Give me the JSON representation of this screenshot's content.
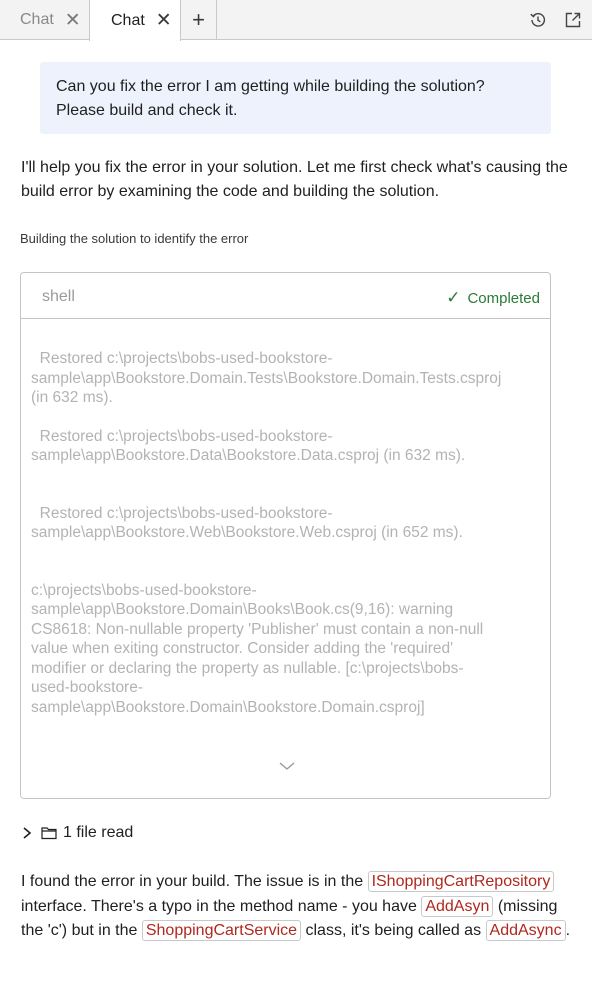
{
  "tabs": [
    {
      "label": "Chat",
      "active": false
    },
    {
      "label": "Chat",
      "active": true
    }
  ],
  "tab_close_glyph": "✕",
  "new_tab_glyph": "+",
  "toolbar_icons": [
    "history-icon",
    "popout-icon"
  ],
  "user_message": "Can you fix the error I am getting while building the solution? Please build and check it.",
  "assistant_intro": "I'll help you fix the error in your solution. Let me first check what's causing the build error by examining the code and building the solution.",
  "step_label": "Building the solution to identify the error",
  "terminal": {
    "title": "shell",
    "status": "Completed",
    "lines": [
      "  Restored c:\\projects\\bobs-used-bookstore-\nsample\\app\\Bookstore.Domain.Tests\\Bookstore.Domain.Tests.csproj\n(in 632 ms).",
      "  Restored c:\\projects\\bobs-used-bookstore-\nsample\\app\\Bookstore.Data\\Bookstore.Data.csproj (in 632 ms).",
      "  Restored c:\\projects\\bobs-used-bookstore-\nsample\\app\\Bookstore.Web\\Bookstore.Web.csproj (in 652 ms).",
      "c:\\projects\\bobs-used-bookstore-\nsample\\app\\Bookstore.Domain\\Books\\Book.cs(9,16): warning\nCS8618: Non-nullable property 'Publisher' must contain a non-null\nvalue when exiting constructor. Consider adding the 'required'\nmodifier or declaring the property as nullable. [c:\\projects\\bobs-\nused-bookstore-\nsample\\app\\Bookstore.Domain\\Bookstore.Domain.csproj]"
    ]
  },
  "file_read": "1 file read",
  "summary": {
    "part1": "I found the error in your build. The issue is in the ",
    "code1": "IShoppingCartRepository",
    "part2": " interface. There's a typo in the method name - you have ",
    "code2": "AddAsyn",
    "part3": " (missing the 'c') but in the ",
    "code3": "ShoppingCartService",
    "part4": " class, it's being called as ",
    "code4": "AddAsync",
    "part5": "."
  },
  "colors": {
    "accent_green": "#2b7a3a",
    "code_red": "#b0281e",
    "user_bubble": "#eef2fc"
  }
}
